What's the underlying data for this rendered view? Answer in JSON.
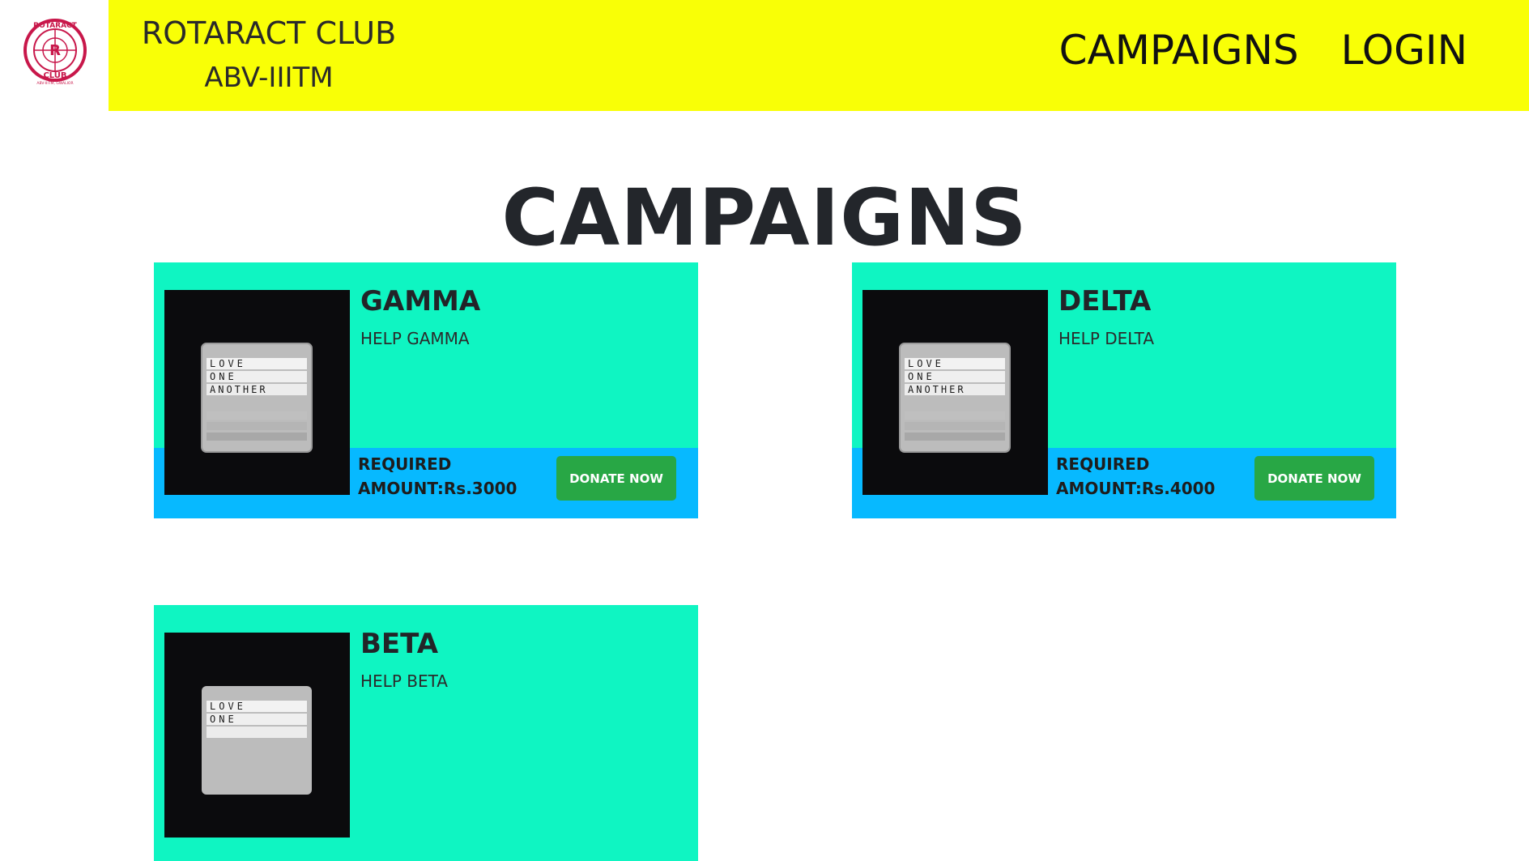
{
  "header": {
    "club_name": "ROTARACT CLUB",
    "club_sub": "ABV-IIITM",
    "logo": {
      "top_text": "ROTARACT",
      "letter": "R",
      "bottom_text": "CLUB",
      "ribbon_text": "ABV-IIITM, GWALIOR",
      "color": "#c8174a"
    },
    "nav": {
      "campaigns": "CAMPAIGNS",
      "login": "LOGIN"
    },
    "bar_color": "#f9ff06"
  },
  "page_title": "CAMPAIGNS",
  "card_image_lines": [
    "LOVE",
    "ONE",
    "ANOTHER"
  ],
  "campaigns": [
    {
      "title": "GAMMA",
      "description": "HELP GAMMA",
      "amount_line1": "REQUIRED",
      "amount_line2": "AMOUNT:Rs.3000",
      "button": "DONATE NOW"
    },
    {
      "title": "DELTA",
      "description": "HELP DELTA",
      "amount_line1": "REQUIRED",
      "amount_line2": "AMOUNT:Rs.4000",
      "button": "DONATE NOW"
    },
    {
      "title": "BETA",
      "description": "HELP BETA",
      "amount_line1": "",
      "amount_line2": "",
      "button": ""
    }
  ],
  "colors": {
    "card_bg": "#0ff5c2",
    "card_band": "#07b9ff",
    "donate_button": "#28a745"
  }
}
